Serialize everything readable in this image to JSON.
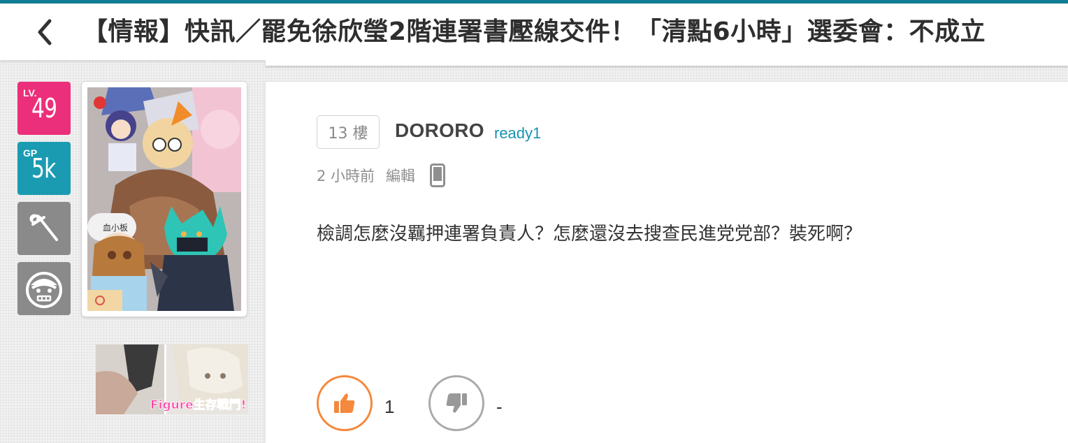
{
  "header": {
    "title": "【情報】快訊／罷免徐欣瑩2階連署書壓線交件！「清點6小時」選委會：不成立",
    "back_icon": "chevron-left-icon"
  },
  "colors": {
    "accent": "#117e96",
    "level_badge": "#ec2f7a",
    "gp_badge": "#1a9bb1",
    "like": "#f5883c",
    "userid": "#1793b2"
  },
  "sidebar": {
    "level": {
      "prefix": "LV.",
      "value": "49"
    },
    "gp": {
      "prefix": "GP",
      "value": "5k"
    },
    "icons": [
      "wrench-icon",
      "monkey-face-icon"
    ],
    "ad_text": "Figure生存戰鬥!"
  },
  "post": {
    "floor": "13 樓",
    "username": "DORORO",
    "userid": "ready1",
    "time": "2 小時前",
    "edit_label": "編輯",
    "device_icon": "mobile-phone-icon",
    "body": "檢調怎麼沒羈押連署負責人？怎麼還沒去搜查民進党党部？裝死啊？",
    "like_count": "1",
    "dislike_count": "-"
  }
}
